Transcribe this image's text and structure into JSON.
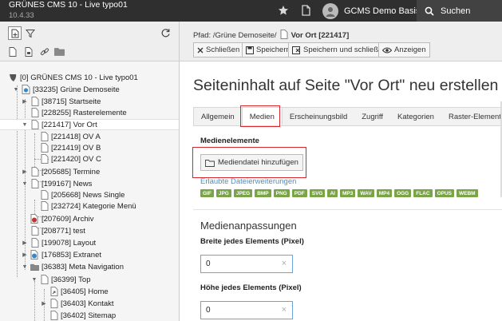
{
  "topbar": {
    "site_name": "GRÜNES CMS 10 - Live typo01",
    "version": "10.4.33",
    "user_name": "GCMS Demo Basis",
    "search_label": "Suchen",
    "icons": [
      "star-icon",
      "document-icon",
      "user-avatar",
      "search-icon"
    ]
  },
  "tree": {
    "toolbar_icons": [
      "new-page-icon",
      "filter-icon",
      "refresh-icon",
      "page-icon",
      "page-edit-icon",
      "link-icon",
      "folder-icon"
    ],
    "items": [
      {
        "label": "[0] GRÜNES CMS 10 - Live typo01"
      },
      {
        "label": "[33235] Grüne Demoseite"
      },
      {
        "label": "[38715] Startseite"
      },
      {
        "label": "[228255] Rasterelemente"
      },
      {
        "label": "[221417] Vor Ort"
      },
      {
        "label": "[221418] OV A"
      },
      {
        "label": "[221419] OV B"
      },
      {
        "label": "[221420] OV C"
      },
      {
        "label": "[205685] Termine"
      },
      {
        "label": "[199167] News"
      },
      {
        "label": "[205668] News Single"
      },
      {
        "label": "[232724] Kategorie Menü"
      },
      {
        "label": "[207609] Archiv"
      },
      {
        "label": "[208771] test"
      },
      {
        "label": "[199078] Layout"
      },
      {
        "label": "[176853] Extranet"
      },
      {
        "label": "[36383] Meta Navigation"
      },
      {
        "label": "[36399] Top"
      },
      {
        "label": "[36405] Home"
      },
      {
        "label": "[36403] Kontakt"
      },
      {
        "label": "[36402] Sitemap"
      }
    ]
  },
  "docheader": {
    "path_prefix": "Pfad: /Grüne Demoseite/",
    "path_page": "Vor Ort [221417]",
    "buttons": {
      "close": "Schließen",
      "save": "Speichern",
      "save_close": "Speichern und schließen",
      "view": "Anzeigen"
    }
  },
  "main": {
    "title": "Seiteninhalt auf Seite \"Vor Ort\" neu erstellen",
    "tabs": [
      "Allgemein",
      "Medien",
      "Erscheinungsbild",
      "Zugriff",
      "Kategorien",
      "Raster-Elemente"
    ],
    "active_tab": "Medien",
    "media_section_title": "Medienelemente",
    "add_media_button": "Mediendatei hinzufügen",
    "allowed_extensions_label": "Erlaubte Dateierweiterungen",
    "extensions": [
      "GIF",
      "JPG",
      "JPEG",
      "BMP",
      "PNG",
      "PDF",
      "SVG",
      "AI",
      "MP3",
      "WAV",
      "MP4",
      "OGG",
      "FLAC",
      "OPUS",
      "WEBM"
    ],
    "adjustments_title": "Medienanpassungen",
    "width_label": "Breite jedes Elements (Pixel)",
    "width_value": "0",
    "height_label": "Höhe jedes Elements (Pixel)",
    "height_value": "0",
    "clear_symbol": "×"
  },
  "colors": {
    "topbar_bg": "#2f2f2f",
    "highlight": "#d9262c",
    "badge": "#79a548",
    "link": "#4a90c2",
    "input_border": "#6da3d6"
  }
}
